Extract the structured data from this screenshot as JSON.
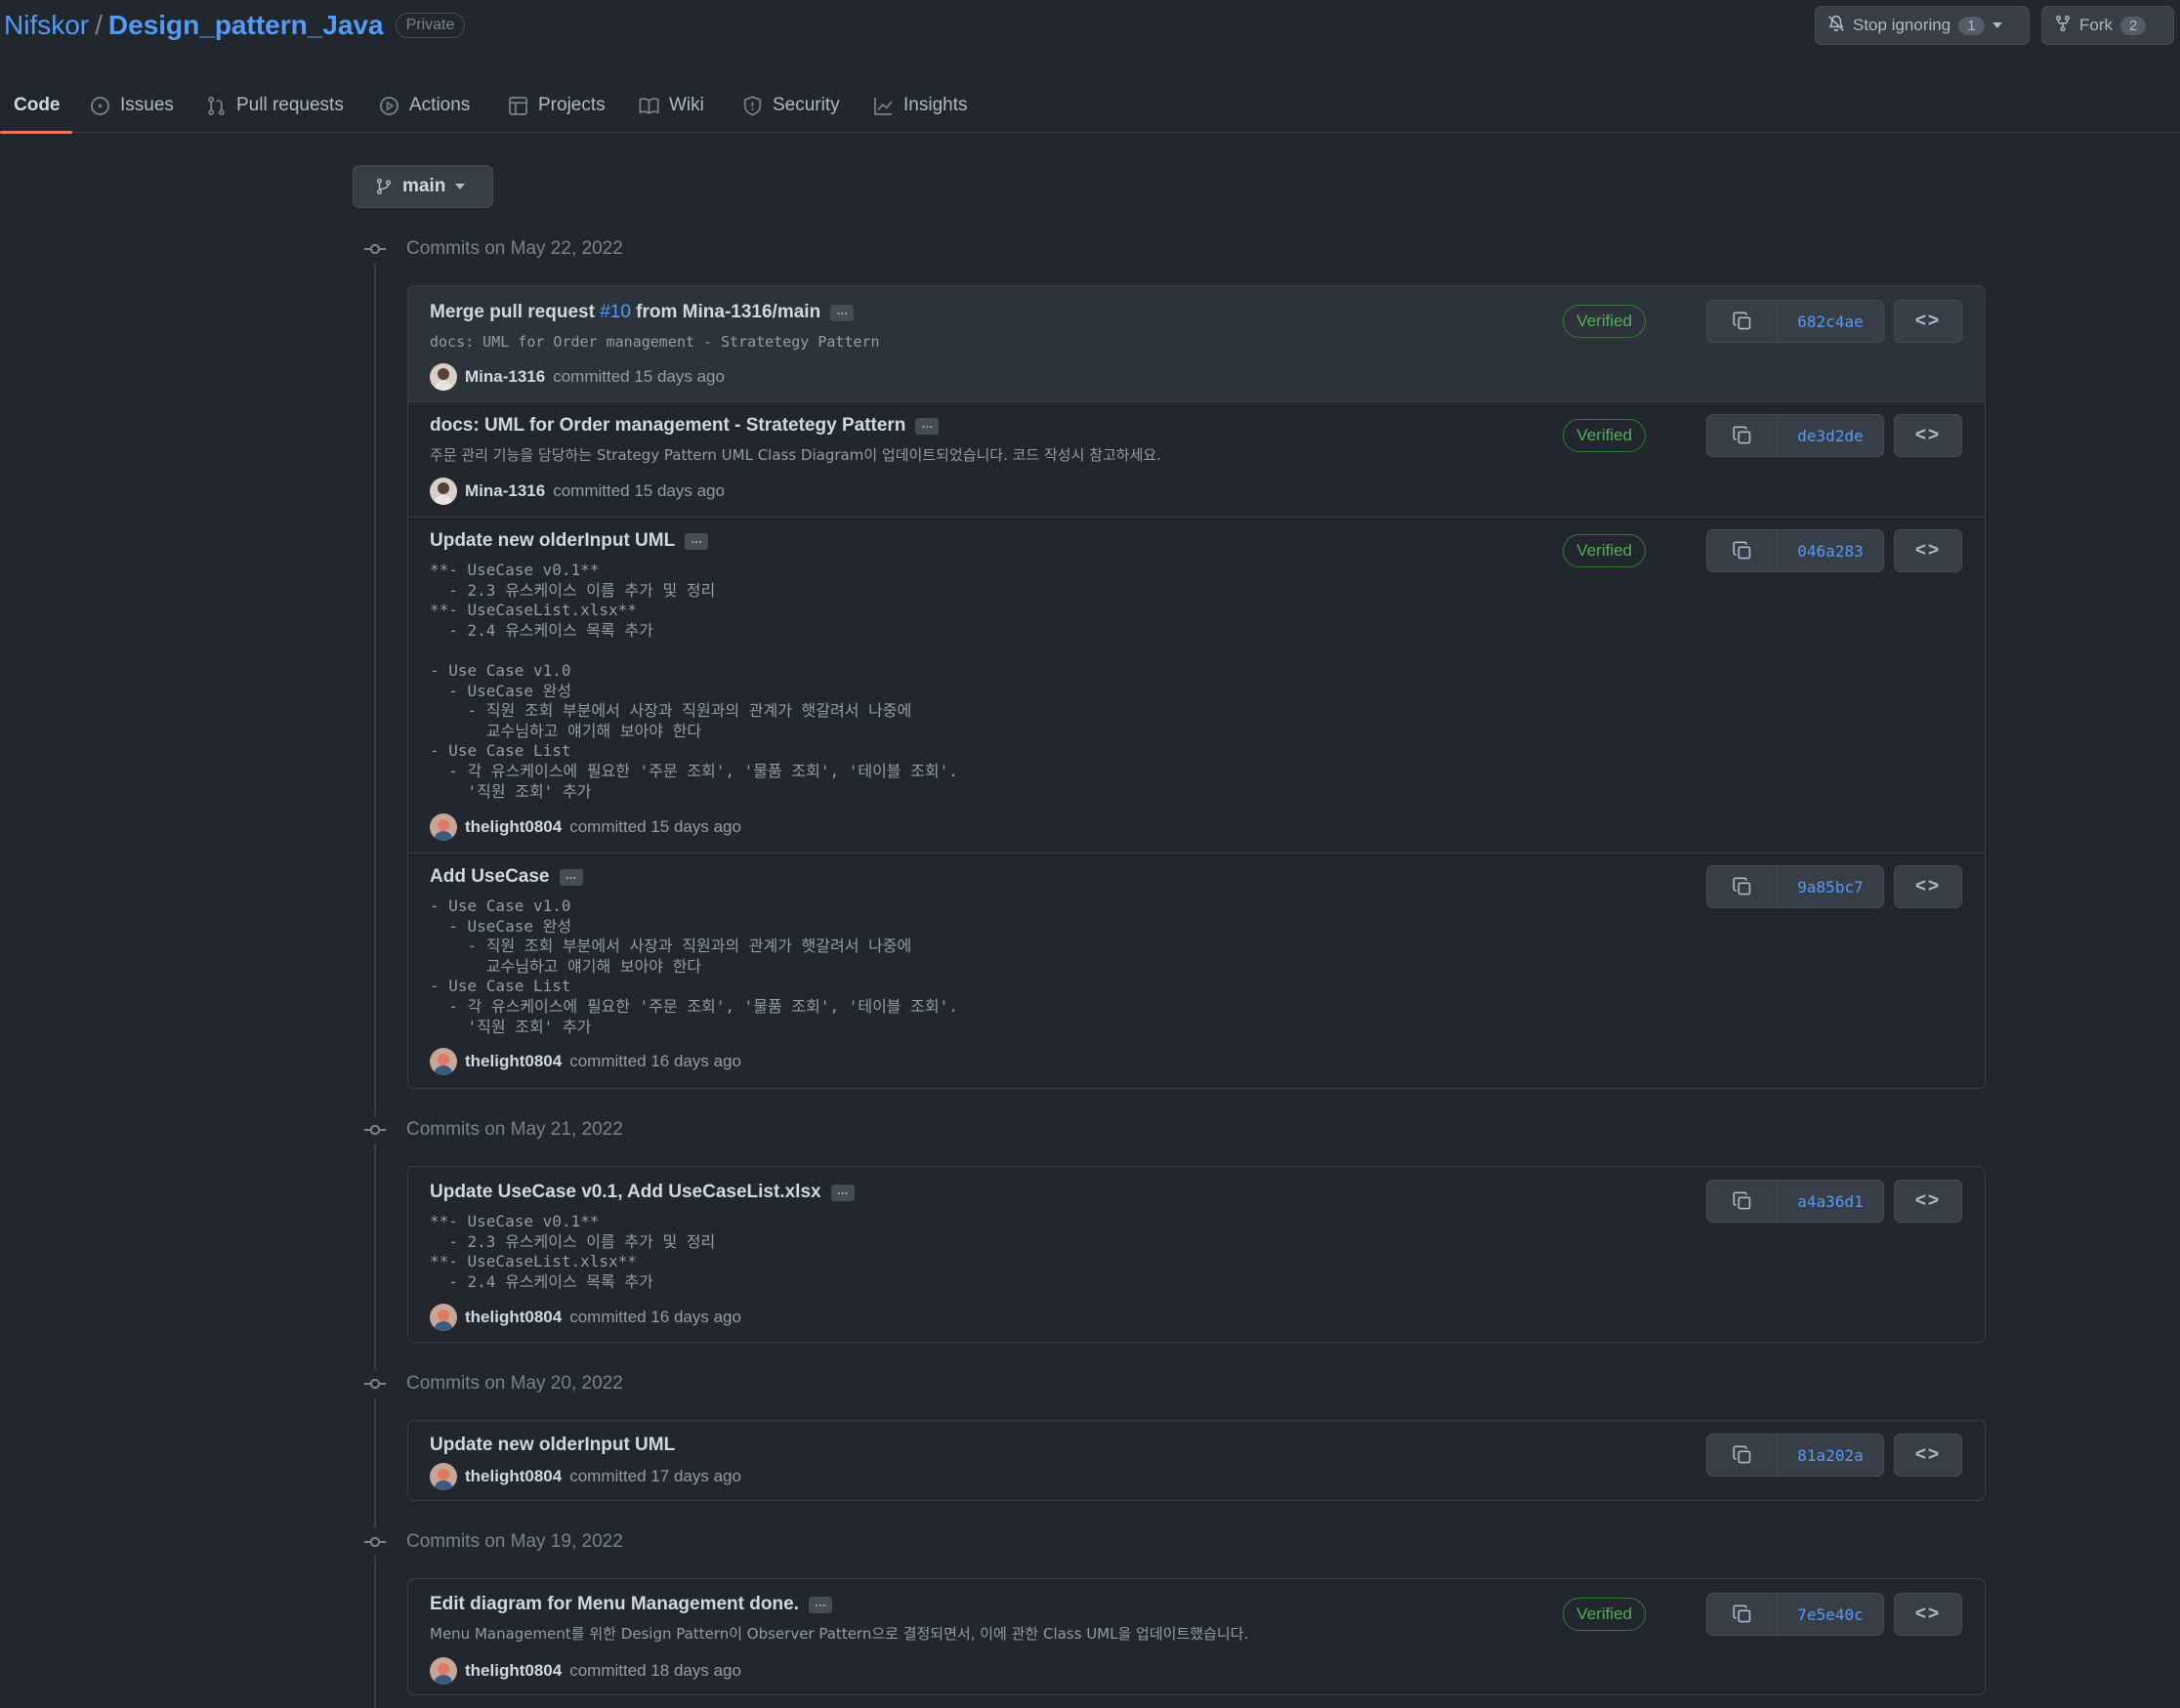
{
  "repo": {
    "owner": "Nifskor",
    "separator": "/",
    "name": "Design_pattern_Java",
    "visibility": "Private"
  },
  "header": {
    "stop_ignoring_label": "Stop ignoring",
    "stop_ignoring_count": "1",
    "fork_label": "Fork",
    "fork_count": "2"
  },
  "tabs": [
    "Code",
    "Issues",
    "Pull requests",
    "Actions",
    "Projects",
    "Wiki",
    "Security",
    "Insights"
  ],
  "branch": "main",
  "days": [
    {
      "label": "Commits on May 22, 2022"
    },
    {
      "label": "Commits on May 21, 2022"
    },
    {
      "label": "Commits on May 20, 2022"
    },
    {
      "label": "Commits on May 19, 2022"
    }
  ],
  "commits": [
    {
      "title_pre": "Merge pull request ",
      "pr": "#10",
      "title_post": " from Mina-1316/main",
      "ellipsis": "…",
      "body": "docs: UML for Order management - Stratetegy Pattern",
      "author": "Mina-1316",
      "meta": "committed 15 days ago",
      "verified": "Verified",
      "sha": "682c4ae"
    },
    {
      "title": "docs: UML for Order management - Stratetegy Pattern",
      "ellipsis": "…",
      "body": "주문 관리 기능을 담당하는 Strategy Pattern UML Class Diagram이 업데이트되었습니다. 코드 작성시 참고하세요.",
      "author": "Mina-1316",
      "meta": "committed 15 days ago",
      "verified": "Verified",
      "sha": "de3d2de"
    },
    {
      "title": "Update new olderInput UML",
      "ellipsis": "…",
      "body": "**- UseCase v0.1**\n  - 2.3 유스케이스 이름 추가 및 정리\n**- UseCaseList.xlsx**\n  - 2.4 유스케이스 목록 추가\n\n- Use Case v1.0\n  - UseCase 완성\n    - 직원 조회 부분에서 사장과 직원과의 관계가 햇갈려서 나중에\n      교수님하고 얘기해 보아야 한다\n- Use Case List\n  - 각 유스케이스에 필요한 '주문 조회', '물품 조회', '테이블 조회'.\n    '직원 조회' 추가",
      "author": "thelight0804",
      "meta": "committed 15 days ago",
      "verified": "Verified",
      "sha": "046a283"
    },
    {
      "title": "Add UseCase",
      "ellipsis": "…",
      "body": "- Use Case v1.0\n  - UseCase 완성\n    - 직원 조회 부분에서 사장과 직원과의 관계가 햇갈려서 나중에\n      교수님하고 얘기해 보아야 한다\n- Use Case List\n  - 각 유스케이스에 필요한 '주문 조회', '물품 조회', '테이블 조회'.\n    '직원 조회' 추가",
      "author": "thelight0804",
      "meta": "committed 16 days ago",
      "sha": "9a85bc7"
    },
    {
      "title": "Update UseCase v0.1, Add UseCaseList.xlsx",
      "ellipsis": "…",
      "body": "**- UseCase v0.1**\n  - 2.3 유스케이스 이름 추가 및 정리\n**- UseCaseList.xlsx**\n  - 2.4 유스케이스 목록 추가",
      "author": "thelight0804",
      "meta": "committed 16 days ago",
      "sha": "a4a36d1"
    },
    {
      "title": "Update new olderInput UML",
      "author": "thelight0804",
      "meta": "committed 17 days ago",
      "sha": "81a202a"
    },
    {
      "title": "Edit diagram for Menu Management done.",
      "ellipsis": "…",
      "body": "Menu Management를 위한 Design Pattern이 Observer Pattern으로 결정되면서, 이에 관한 Class UML을 업데이트했습니다.",
      "author": "thelight0804",
      "meta": "committed 18 days ago",
      "verified": "Verified",
      "sha": "7e5e40c"
    }
  ],
  "browse_label": "<>",
  "colors": {
    "bg": "#22272e",
    "link": "#539bf5",
    "verified": "#57ab5a",
    "tab_underline": "#ec775c"
  }
}
